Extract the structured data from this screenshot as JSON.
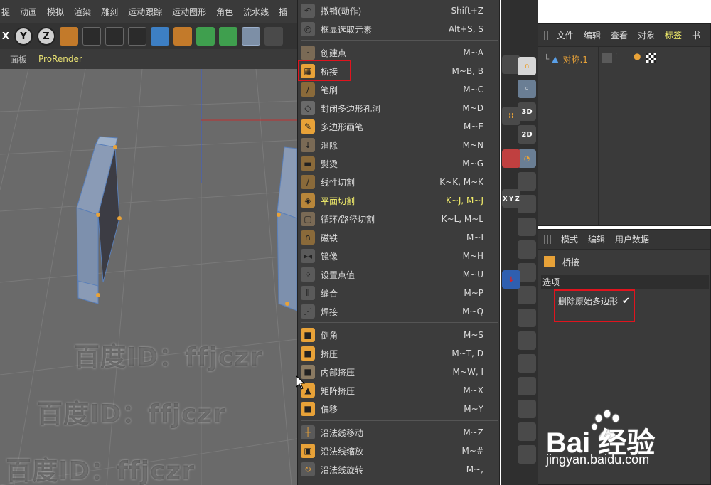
{
  "menubar": {
    "items": [
      "捉",
      "动画",
      "模拟",
      "渲染",
      "雕刻",
      "运动跟踪",
      "运动图形",
      "角色",
      "流水线",
      "插"
    ]
  },
  "toolbar": {
    "x_label": "X",
    "y_label": "Y",
    "z_label": "Z"
  },
  "viewport": {
    "tabs": [
      "面板",
      "ProRender"
    ]
  },
  "watermark": {
    "text": "百度ID：ffjczr"
  },
  "context_menu": {
    "items": [
      {
        "label": "撤销(动作)",
        "shortcut": "Shift+Z",
        "icon": "undo-icon"
      },
      {
        "label": "框显选取元素",
        "shortcut": "Alt+S, S",
        "icon": "frame-selection-icon"
      },
      {
        "label": "创建点",
        "shortcut": "M~A",
        "icon": "create-point-icon"
      },
      {
        "label": "桥接",
        "shortcut": "M~B, B",
        "icon": "bridge-icon"
      },
      {
        "label": "笔刷",
        "shortcut": "M~C",
        "icon": "brush-icon"
      },
      {
        "label": "封闭多边形孔洞",
        "shortcut": "M~D",
        "icon": "close-hole-icon"
      },
      {
        "label": "多边形画笔",
        "shortcut": "M~E",
        "icon": "polygon-pen-icon"
      },
      {
        "label": "消除",
        "shortcut": "M~N",
        "icon": "dissolve-icon"
      },
      {
        "label": "熨烫",
        "shortcut": "M~G",
        "icon": "iron-icon"
      },
      {
        "label": "线性切割",
        "shortcut": "K~K, M~K",
        "icon": "knife-icon"
      },
      {
        "label": "平面切割",
        "shortcut": "K~J, M~J",
        "icon": "plane-cut-icon"
      },
      {
        "label": "循环/路径切割",
        "shortcut": "K~L, M~L",
        "icon": "loop-cut-icon"
      },
      {
        "label": "磁铁",
        "shortcut": "M~I",
        "icon": "magnet-icon"
      },
      {
        "label": "镜像",
        "shortcut": "M~H",
        "icon": "mirror-icon"
      },
      {
        "label": "设置点值",
        "shortcut": "M~U",
        "icon": "set-point-value-icon"
      },
      {
        "label": "缝合",
        "shortcut": "M~P",
        "icon": "stitch-icon"
      },
      {
        "label": "焊接",
        "shortcut": "M~Q",
        "icon": "weld-icon"
      },
      {
        "label": "倒角",
        "shortcut": "M~S",
        "icon": "bevel-icon"
      },
      {
        "label": "挤压",
        "shortcut": "M~T, D",
        "icon": "extrude-icon"
      },
      {
        "label": "内部挤压",
        "shortcut": "M~W, I",
        "icon": "extrude-inner-icon"
      },
      {
        "label": "矩阵挤压",
        "shortcut": "M~X",
        "icon": "matrix-extrude-icon"
      },
      {
        "label": "偏移",
        "shortcut": "M~Y",
        "icon": "smooth-shift-icon"
      },
      {
        "label": "沿法线移动",
        "shortcut": "M~Z",
        "icon": "normal-move-icon"
      },
      {
        "label": "沿法线缩放",
        "shortcut": "M~#",
        "icon": "normal-scale-icon"
      },
      {
        "label": "沿法线旋转",
        "shortcut": "M~,",
        "icon": "normal-rotate-icon"
      }
    ]
  },
  "strip": {
    "label_3d": "3D",
    "label_2d": "2D",
    "label_xyz": "X Y Z"
  },
  "object_manager": {
    "tabs": [
      "文件",
      "编辑",
      "查看",
      "对象",
      "标签",
      "书"
    ],
    "object_name": "对称.1"
  },
  "attribute_manager": {
    "tabs": [
      "模式",
      "编辑",
      "用户数据"
    ],
    "tool_name": "桥接",
    "section": "选项",
    "option_label": "删除原始多边形",
    "option_check": "✔"
  },
  "baidu": {
    "brand": "Bai  经验",
    "url": "jingyan.baidu.com"
  },
  "colors": {
    "highlight": "#f4ef6b",
    "annotation_box": "#e0141e",
    "object_name": "#e8a238"
  }
}
